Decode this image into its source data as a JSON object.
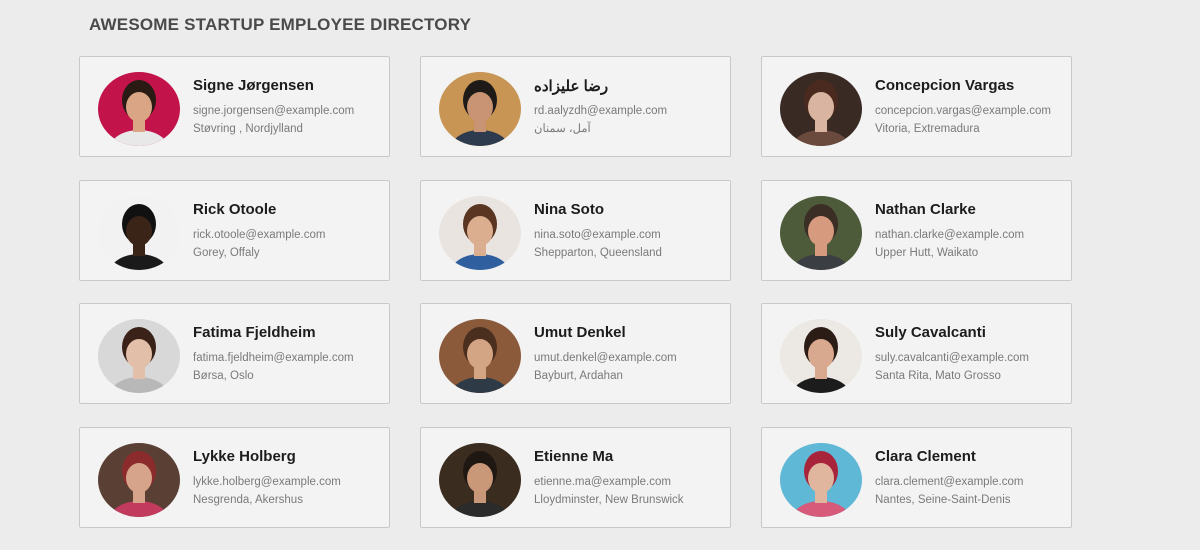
{
  "page": {
    "title": "AWESOME STARTUP EMPLOYEE DIRECTORY"
  },
  "employees": [
    {
      "name": "Signe Jørgensen",
      "email": "signe.jorgensen@example.com",
      "location": "Støvring , Nordjylland",
      "avatar": {
        "bg": "#c2134a",
        "skin": "#d9a585",
        "hair": "#2a1a14",
        "shirt": "#e8e8e8"
      }
    },
    {
      "name": "رضا علیزاده",
      "email": "rd.aalyzdh@example.com",
      "location": "آمل، سمنان",
      "avatar": {
        "bg": "#c99555",
        "skin": "#c99474",
        "hair": "#1d1a17",
        "shirt": "#2e3b4f"
      }
    },
    {
      "name": "Concepcion Vargas",
      "email": "concepcion.vargas@example.com",
      "location": "Vitoria, Extremadura",
      "avatar": {
        "bg": "#3a2a24",
        "skin": "#d9b4a0",
        "hair": "#4a2a1e",
        "shirt": "#6b4a3e"
      }
    },
    {
      "name": "Rick Otoole",
      "email": "rick.otoole@example.com",
      "location": "Gorey, Offaly",
      "avatar": {
        "bg": "#f2f2f2",
        "skin": "#3a2418",
        "hair": "#111111",
        "shirt": "#1a1a1a"
      }
    },
    {
      "name": "Nina Soto",
      "email": "nina.soto@example.com",
      "location": "Shepparton, Queensland",
      "avatar": {
        "bg": "#e9e4df",
        "skin": "#dcae90",
        "hair": "#5a3522",
        "shirt": "#2f5f9e"
      }
    },
    {
      "name": "Nathan Clarke",
      "email": "nathan.clarke@example.com",
      "location": "Upper Hutt, Waikato",
      "avatar": {
        "bg": "#4e5b3a",
        "skin": "#d69b7e",
        "hair": "#3a2e25",
        "shirt": "#3b3f44"
      }
    },
    {
      "name": "Fatima Fjeldheim",
      "email": "fatima.fjeldheim@example.com",
      "location": "Børsa, Oslo",
      "avatar": {
        "bg": "#d8d8d8",
        "skin": "#e1bfa8",
        "hair": "#3b2219",
        "shirt": "#b8b8b8"
      }
    },
    {
      "name": "Umut Denkel",
      "email": "umut.denkel@example.com",
      "location": "Bayburt, Ardahan",
      "avatar": {
        "bg": "#8a5a3a",
        "skin": "#d4a585",
        "hair": "#4a2e1e",
        "shirt": "#2e3a46"
      }
    },
    {
      "name": "Suly Cavalcanti",
      "email": "suly.cavalcanti@example.com",
      "location": "Santa Rita, Mato Grosso",
      "avatar": {
        "bg": "#ece8e3",
        "skin": "#d8a98e",
        "hair": "#2b1c16",
        "shirt": "#1c1c1c"
      }
    },
    {
      "name": "Lykke Holberg",
      "email": "lykke.holberg@example.com",
      "location": "Nesgrenda, Akershus",
      "avatar": {
        "bg": "#5a3f34",
        "skin": "#d6a48a",
        "hair": "#8b2b2b",
        "shirt": "#c23a5e"
      }
    },
    {
      "name": "Etienne Ma",
      "email": "etienne.ma@example.com",
      "location": "Lloydminster, New Brunswick",
      "avatar": {
        "bg": "#3a2c1e",
        "skin": "#c99878",
        "hair": "#1e1712",
        "shirt": "#2b2b2b"
      }
    },
    {
      "name": "Clara Clement",
      "email": "clara.clement@example.com",
      "location": "Nantes, Seine-Saint-Denis",
      "avatar": {
        "bg": "#5fb8d6",
        "skin": "#e0b69e",
        "hair": "#a8243a",
        "shirt": "#d85a7a"
      }
    }
  ]
}
